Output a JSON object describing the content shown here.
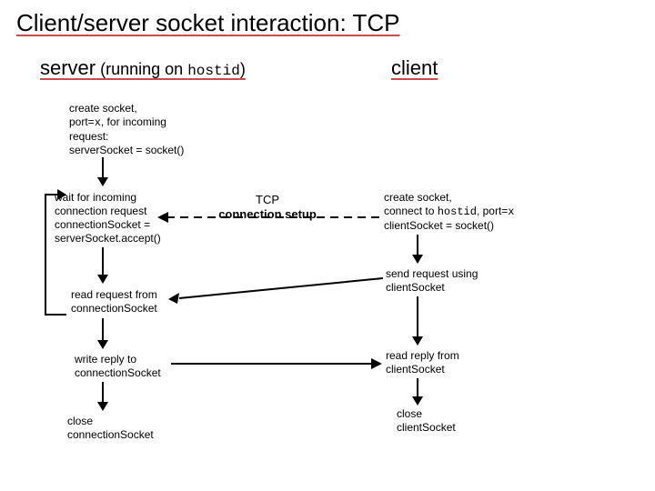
{
  "title": "Client/server socket interaction: TCP",
  "server_heading_prefix": "server",
  "server_heading_paren": " (running on ",
  "server_heading_hostid": "hostid",
  "server_heading_close": ")",
  "client_heading": "client",
  "server_step1_l1": "create socket,",
  "server_step1_l2a": "port=",
  "server_step1_l2b": "x",
  "server_step1_l2c": ", for incoming",
  "server_step1_l3": "request:",
  "server_step1_l4": "serverSocket = socket()",
  "server_step2_l1": "wait for incoming",
  "server_step2_l2": "connection request",
  "server_step2_l3": "connectionSocket =",
  "server_step2_l4": "serverSocket.accept()",
  "server_step3_l1": "read request from",
  "server_step3_l2": "connectionSocket",
  "server_step4_l1": "write reply to",
  "server_step4_l2": "connectionSocket",
  "server_step5_l1": "close",
  "server_step5_l2": "connectionSocket",
  "tcp_l1": "TCP",
  "tcp_l2": "connection setup",
  "client_step1_l1": "create socket,",
  "client_step1_l2a": "connect to ",
  "client_step1_l2b": "hostid",
  "client_step1_l2c": ", port=",
  "client_step1_l2d": "x",
  "client_step1_l3": "clientSocket = socket()",
  "client_step2_l1": "send request using",
  "client_step2_l2": "clientSocket",
  "client_step3_l1": "read reply from",
  "client_step3_l2": "clientSocket",
  "client_step4_l1": "close",
  "client_step4_l2": "clientSocket"
}
